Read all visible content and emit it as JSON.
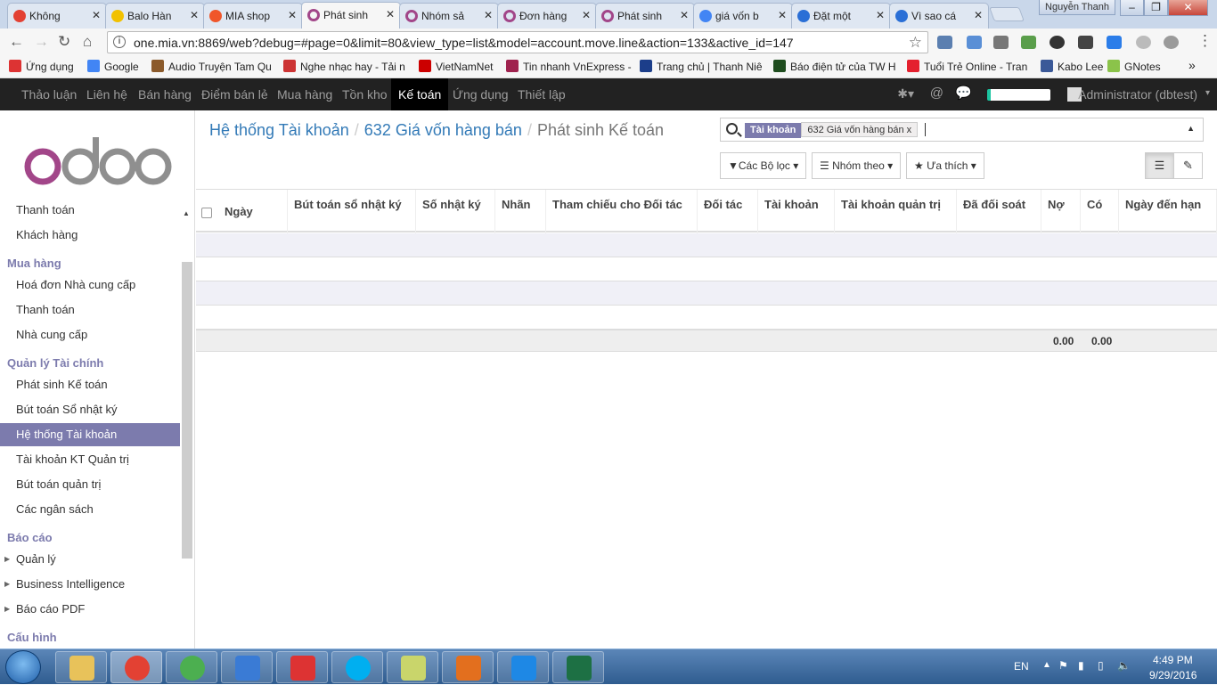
{
  "browser": {
    "tabs": [
      {
        "label": "Không",
        "icon": "chrome-icon",
        "color": "#e34133",
        "active": false
      },
      {
        "label": "Balo Hàn",
        "icon": "b-icon",
        "color": "#f2c100",
        "active": false
      },
      {
        "label": "MIA shop",
        "icon": "mia-icon",
        "color": "#f0562a",
        "active": false
      },
      {
        "label": "Phát sinh",
        "icon": "odoo-icon",
        "color": "#a24689",
        "active": true
      },
      {
        "label": "Nhóm sả",
        "icon": "odoo-icon",
        "color": "#a24689",
        "active": false
      },
      {
        "label": "Đơn hàng",
        "icon": "odoo-icon",
        "color": "#a24689",
        "active": false
      },
      {
        "label": "Phát sinh",
        "icon": "odoo-icon",
        "color": "#a24689",
        "active": false
      },
      {
        "label": "giá vốn b",
        "icon": "google-icon",
        "color": "#4285f4",
        "active": false
      },
      {
        "label": "Đặt một",
        "icon": "grid-icon",
        "color": "#2a6fd6",
        "active": false
      },
      {
        "label": "Vì sao cá",
        "icon": "grid-icon",
        "color": "#2a6fd6",
        "active": false
      }
    ],
    "window_user": "Nguyễn Thanh",
    "url": "one.mia.vn:8869/web?debug=#page=0&limit=80&view_type=list&model=account.move.line&action=133&active_id=147",
    "bookmarks": [
      {
        "label": "Ứng dụng",
        "icon": "apps-icon",
        "color": "#d33"
      },
      {
        "label": "Google",
        "icon": "google-icon",
        "color": "#4285f4"
      },
      {
        "label": "Audio Truyện Tam Qu",
        "icon": "audio-icon",
        "color": "#8b5a2b"
      },
      {
        "label": "Nghe nhạc hay - Tải n",
        "icon": "music-icon",
        "color": "#c33"
      },
      {
        "label": "VietNamNet",
        "icon": "check-icon",
        "color": "#c00"
      },
      {
        "label": "Tin nhanh VnExpress -",
        "icon": "vnexpress-icon",
        "color": "#9f224e"
      },
      {
        "label": "Trang chủ | Thanh Niê",
        "icon": "thanhnien-icon",
        "color": "#1c3e8a"
      },
      {
        "label": "Báo điện tử của TW H",
        "icon": "d-icon",
        "color": "#1f4d1f"
      },
      {
        "label": "Tuổi Trẻ Online - Tran",
        "icon": "tuoitre-icon",
        "color": "#e4202e"
      },
      {
        "label": "Kabo Lee",
        "icon": "facebook-icon",
        "color": "#3b5998"
      },
      {
        "label": "GNotes",
        "icon": "gnotes-icon",
        "color": "#8bc34a"
      }
    ],
    "bookmarks_more": "»"
  },
  "topnav": {
    "menus": [
      "Thảo luận",
      "Liên hệ",
      "Bán hàng",
      "Điểm bán lẻ",
      "Mua hàng",
      "Tồn kho",
      "Kế toán",
      "Ứng dụng",
      "Thiết lập"
    ],
    "active_menu": "Kế toán",
    "user": "Administrator (dbtest)"
  },
  "sidebar": {
    "items": [
      {
        "type": "item",
        "label": "Thanh toán"
      },
      {
        "type": "item",
        "label": "Khách hàng"
      },
      {
        "type": "head",
        "label": "Mua hàng"
      },
      {
        "type": "item",
        "label": "Hoá đơn Nhà cung cấp"
      },
      {
        "type": "item",
        "label": "Thanh toán"
      },
      {
        "type": "item",
        "label": "Nhà cung cấp"
      },
      {
        "type": "head",
        "label": "Quản lý Tài chính"
      },
      {
        "type": "item",
        "label": "Phát sinh Kế toán"
      },
      {
        "type": "item",
        "label": "Bút toán Sổ nhật ký"
      },
      {
        "type": "item",
        "label": "Hệ thống Tài khoản",
        "active": true
      },
      {
        "type": "item",
        "label": "Tài khoản KT Quản trị"
      },
      {
        "type": "item",
        "label": "Bút toán quản trị"
      },
      {
        "type": "item",
        "label": "Các ngân sách"
      },
      {
        "type": "head",
        "label": "Báo cáo"
      },
      {
        "type": "item",
        "label": "Quản lý",
        "caret": true
      },
      {
        "type": "item",
        "label": "Business Intelligence",
        "caret": true
      },
      {
        "type": "item",
        "label": "Báo cáo PDF",
        "caret": true
      },
      {
        "type": "head",
        "label": "Cấu hình"
      }
    ]
  },
  "breadcrumb": {
    "items": [
      "Hệ thống Tài khoản",
      "632 Giá vốn hàng bán"
    ],
    "current": "Phát sinh Kế toán"
  },
  "search": {
    "facet_category": "Tài khoản",
    "facet_value": "632 Giá vốn hàng bán",
    "facet_remove": "x"
  },
  "toolbar": {
    "filters": "Các Bộ lọc",
    "group_by": "Nhóm theo",
    "favorites": "Ưa thích"
  },
  "table": {
    "columns": [
      "Ngày",
      "Bút toán sổ nhật ký",
      "Số nhật ký",
      "Nhãn",
      "Tham chiếu cho Đối tác",
      "Đối tác",
      "Tài khoản",
      "Tài khoản quản trị",
      "Đã đối soát",
      "Nợ",
      "Có",
      "Ngày đến hạn"
    ],
    "empty_rows": 4,
    "total_debit": "0.00",
    "total_credit": "0.00"
  },
  "taskbar": {
    "apps": [
      "explorer-icon",
      "chrome-icon",
      "coccoc-icon",
      "media-player-icon",
      "snipping-tool-icon",
      "skype-icon",
      "sticky-notes-icon",
      "outlook-icon",
      "teamviewer-icon",
      "excel-icon"
    ],
    "active_app": "chrome-icon",
    "language": "EN",
    "time": "4:49 PM",
    "date": "9/29/2016"
  }
}
